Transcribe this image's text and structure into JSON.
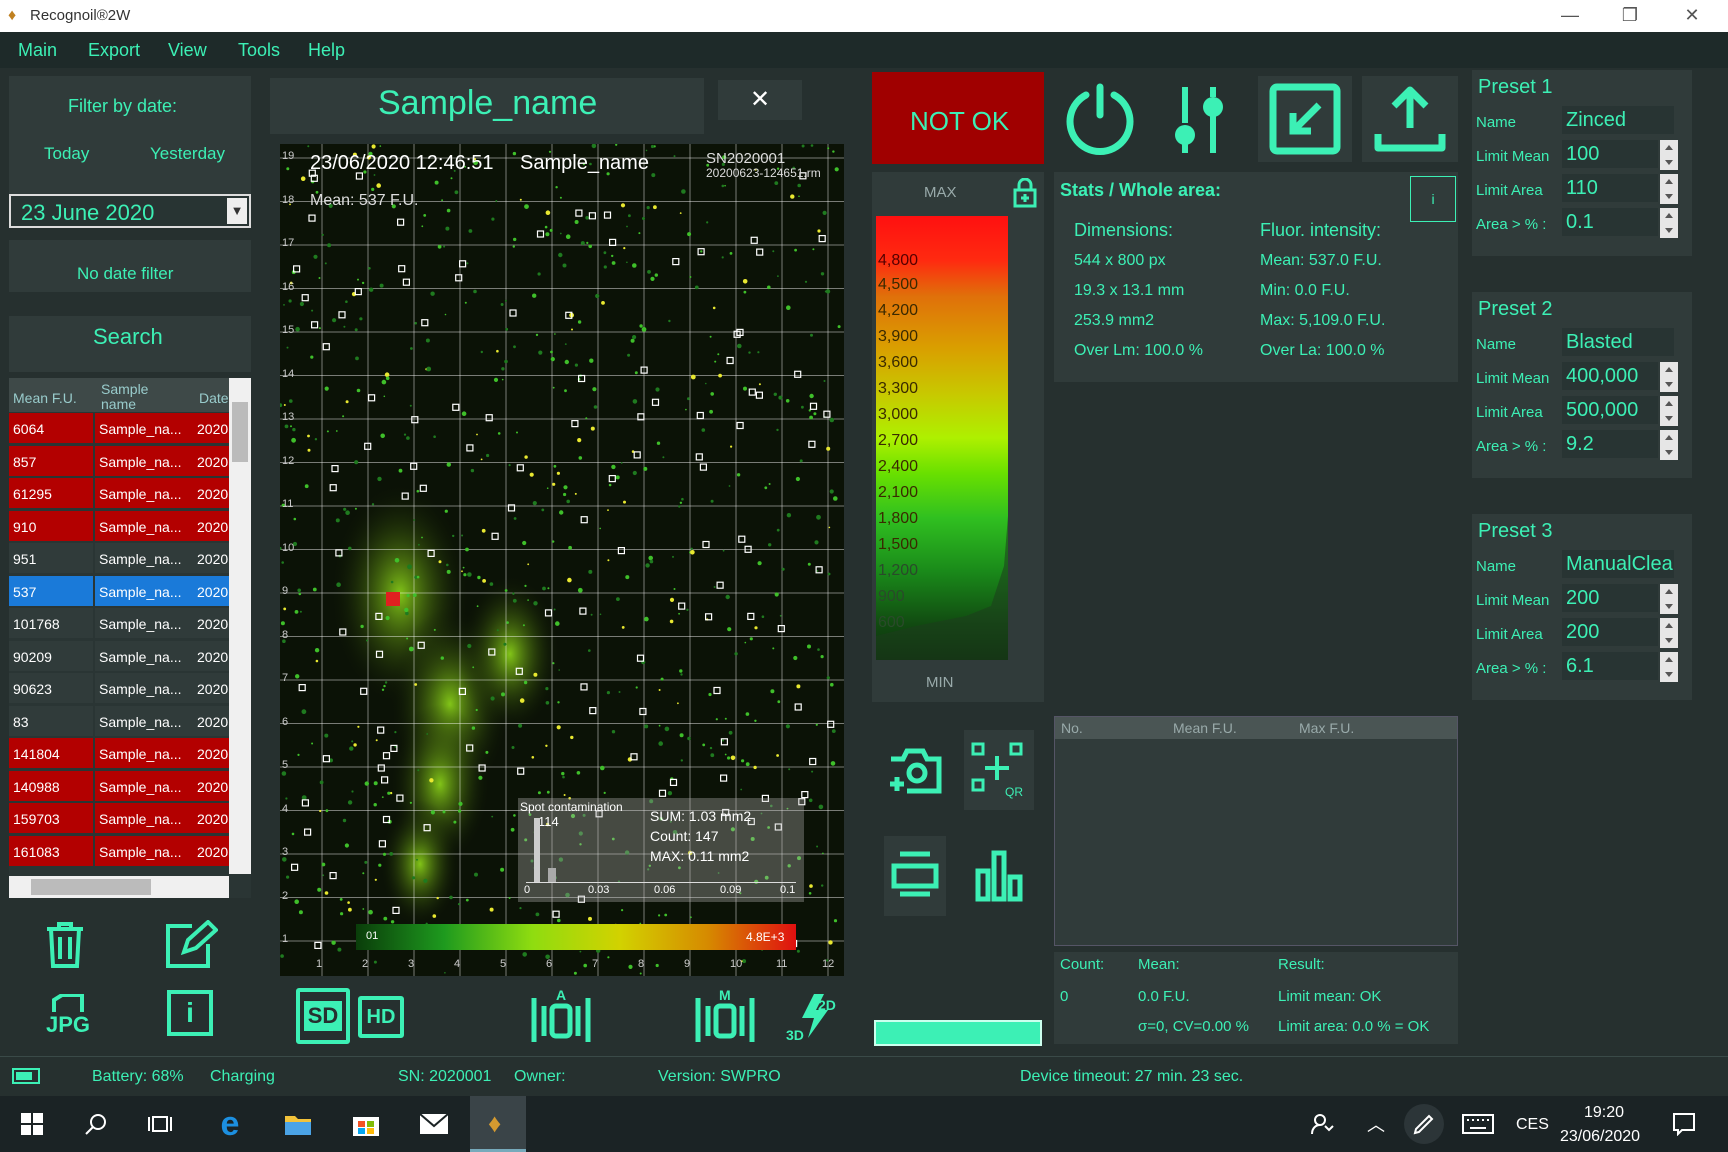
{
  "window": {
    "title": "Recognoil®2W"
  },
  "menu": [
    "Main",
    "Export",
    "View",
    "Tools",
    "Help"
  ],
  "filter": {
    "heading": "Filter by date:",
    "today": "Today",
    "yesterday": "Yesterday",
    "date": "23 June 2020",
    "no_filter": "No date filter",
    "search": "Search"
  },
  "table": {
    "headers": [
      "Mean F.U.",
      "Sample name",
      "Date"
    ],
    "rows": [
      {
        "mean": "6064",
        "name": "Sample_na...",
        "date": "2020",
        "color": "#b30000"
      },
      {
        "mean": "857",
        "name": "Sample_na...",
        "date": "2020",
        "color": "#b30000"
      },
      {
        "mean": "61295",
        "name": "Sample_na...",
        "date": "2020",
        "color": "#b30000"
      },
      {
        "mean": "910",
        "name": "Sample_na...",
        "date": "2020",
        "color": "#b30000"
      },
      {
        "mean": "951",
        "name": "Sample_na...",
        "date": "2020",
        "color": "#303b3a"
      },
      {
        "mean": "537",
        "name": "Sample_na...",
        "date": "2020",
        "color": "#1a7ad9"
      },
      {
        "mean": "101768",
        "name": "Sample_na...",
        "date": "2020",
        "color": "#303b3a"
      },
      {
        "mean": "90209",
        "name": "Sample_na...",
        "date": "2020",
        "color": "#303b3a"
      },
      {
        "mean": "90623",
        "name": "Sample_na...",
        "date": "2020",
        "color": "#303b3a"
      },
      {
        "mean": "83",
        "name": "Sample_na...",
        "date": "2020",
        "color": "#303b3a"
      },
      {
        "mean": "141804",
        "name": "Sample_na...",
        "date": "2020",
        "color": "#b30000"
      },
      {
        "mean": "140988",
        "name": "Sample_na...",
        "date": "2020",
        "color": "#b30000"
      },
      {
        "mean": "159703",
        "name": "Sample_na...",
        "date": "2020",
        "color": "#b30000"
      },
      {
        "mean": "161083",
        "name": "Sample_na...",
        "date": "2020",
        "color": "#b30000"
      }
    ]
  },
  "sample": {
    "name": "Sample_name",
    "close": "✕"
  },
  "image": {
    "datetime": "23/06/2020 12:46:51",
    "name": "Sample_name",
    "sn": "SN2020001",
    "file": "20200623-124651.rm",
    "mean": "Mean: 537 F.U.",
    "spot_title": "Spot contamination",
    "spot_val": "114",
    "sum": "SUM: 1.03 mm2",
    "count": "Count: 147",
    "max": "MAX: 0.11 mm2",
    "hist_ticks": [
      "0",
      "0.03",
      "0.06",
      "0.09",
      "0.1"
    ],
    "colorbar_max": "4.8E+3",
    "colorbar_min": "01",
    "y_ticks": [
      "19",
      "18",
      "17",
      "16",
      "15",
      "14",
      "13",
      "12",
      "11",
      "10",
      "9",
      "8",
      "7",
      "6",
      "5",
      "4",
      "3",
      "2",
      "1"
    ],
    "x_ticks": [
      "1",
      "2",
      "3",
      "4",
      "5",
      "6",
      "7",
      "8",
      "9",
      "10",
      "11",
      "12"
    ]
  },
  "result": {
    "status": "NOT OK",
    "status_color": "#a00000"
  },
  "scale": {
    "max": "MAX",
    "min": "MIN",
    "labels": [
      "4,800",
      "4,500",
      "4,200",
      "3,900",
      "3,600",
      "3,300",
      "3,000",
      "2,700",
      "2,400",
      "2,100",
      "1,800",
      "1,500",
      "1,200",
      "900",
      "600"
    ]
  },
  "stats": {
    "title": "Stats / Whole area:",
    "dim_h": "Dimensions:",
    "fluor_h": "Fluor. intensity:",
    "dims": [
      "544 x 800 px",
      "19.3 x 13.1 mm",
      "253.9 mm2",
      "Over Lm: 100.0 %"
    ],
    "fluor": [
      "Mean: 537.0 F.U.",
      "Min: 0.0 F.U.",
      "Max: 5,109.0 F.U.",
      "Over La: 100.0 %"
    ],
    "info": "i"
  },
  "spots": {
    "headers": [
      "No.",
      "Mean F.U.",
      "Max F.U."
    ]
  },
  "summary": {
    "count_h": "Count:",
    "mean_h": "Mean:",
    "result_h": "Result:",
    "count": "0",
    "mean": "0.0 F.U.",
    "cv": "σ=0, CV=0.00 %",
    "lim_mean": "Limit mean:  OK",
    "lim_area": "Limit area:  0.0 % = OK"
  },
  "presets": [
    {
      "title": "Preset 1",
      "name": "Zinced",
      "limit_mean": "100",
      "limit_area": "110",
      "area_pct": "0.1"
    },
    {
      "title": "Preset 2",
      "name": "Blasted",
      "limit_mean": "400,000",
      "limit_area": "500,000",
      "area_pct": "9.2"
    },
    {
      "title": "Preset 3",
      "name": "ManualCleaned",
      "limit_mean": "200",
      "limit_area": "200",
      "area_pct": "6.1"
    }
  ],
  "preset_labels": {
    "name": "Name",
    "limit_mean": "Limit Mean",
    "limit_area": "Limit Area",
    "area_pct": "Area > % :"
  },
  "icon_labels": {
    "jpg": "JPG",
    "sd": "SD",
    "hd": "HD",
    "qr": "QR",
    "a": "A",
    "m": "M",
    "d2": "2D",
    "d3": "3D"
  },
  "status": {
    "battery": "Battery: 68%",
    "charging": "Charging",
    "sn": "SN: 2020001",
    "owner": "Owner:",
    "version": "Version: SWPRO",
    "timeout": "Device timeout: 27 min. 23 sec."
  },
  "taskbar": {
    "lang": "CES",
    "time": "19:20",
    "date": "23/06/2020"
  },
  "colors": {
    "accent": "#3cf0b5",
    "bg": "#26302f",
    "panel": "#303b3a"
  }
}
